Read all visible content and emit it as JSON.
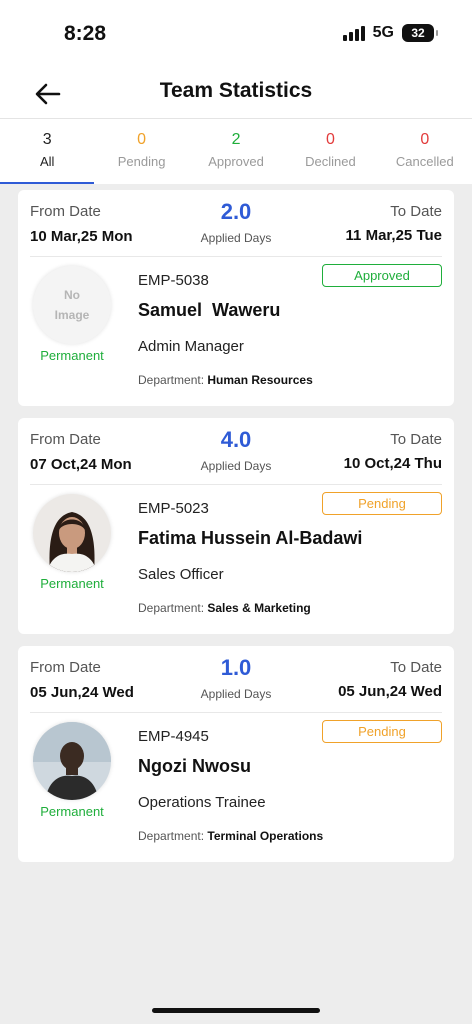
{
  "status_bar": {
    "time": "8:28",
    "network": "5G",
    "battery": "32"
  },
  "header": {
    "title": "Team Statistics",
    "back_icon": "arrow-left-icon"
  },
  "tabs": [
    {
      "count": "3",
      "label": "All",
      "color": "#222222",
      "active": true
    },
    {
      "count": "0",
      "label": "Pending",
      "color": "#f0a22a"
    },
    {
      "count": "2",
      "label": "Approved",
      "color": "#1fae3b"
    },
    {
      "count": "0",
      "label": "Declined",
      "color": "#e23b3b"
    },
    {
      "count": "0",
      "label": "Cancelled",
      "color": "#e23b3b"
    }
  ],
  "labels": {
    "from": "From Date",
    "to": "To Date",
    "applied": "Applied Days",
    "department": "Department:"
  },
  "requests": [
    {
      "from_date": "10 Mar,25 Mon",
      "to_date": "11 Mar,25 Tue",
      "days": "2.0",
      "emp_id": "EMP-5038",
      "name": "Samuel  Waweru",
      "role": "Admin Manager",
      "department": "Human Resources",
      "status": "Approved",
      "employment": "Permanent",
      "avatar": {
        "no_image_line1": "No",
        "no_image_line2": "Image"
      }
    },
    {
      "from_date": "07 Oct,24 Mon",
      "to_date": "10 Oct,24 Thu",
      "days": "4.0",
      "emp_id": "EMP-5023",
      "name": "Fatima Hussein Al-Badawi",
      "role": "Sales Officer",
      "department": "Sales & Marketing",
      "status": "Pending",
      "employment": "Permanent"
    },
    {
      "from_date": "05 Jun,24 Wed",
      "to_date": "05 Jun,24 Wed",
      "days": "1.0",
      "emp_id": "EMP-4945",
      "name": "Ngozi Nwosu",
      "role": "Operations Trainee",
      "department": "Terminal Operations",
      "status": "Pending",
      "employment": "Permanent"
    }
  ],
  "colors": {
    "accent": "#2f5bd6",
    "approved": "#1fae3b",
    "pending": "#f0a22a",
    "declined": "#e23b3b"
  }
}
